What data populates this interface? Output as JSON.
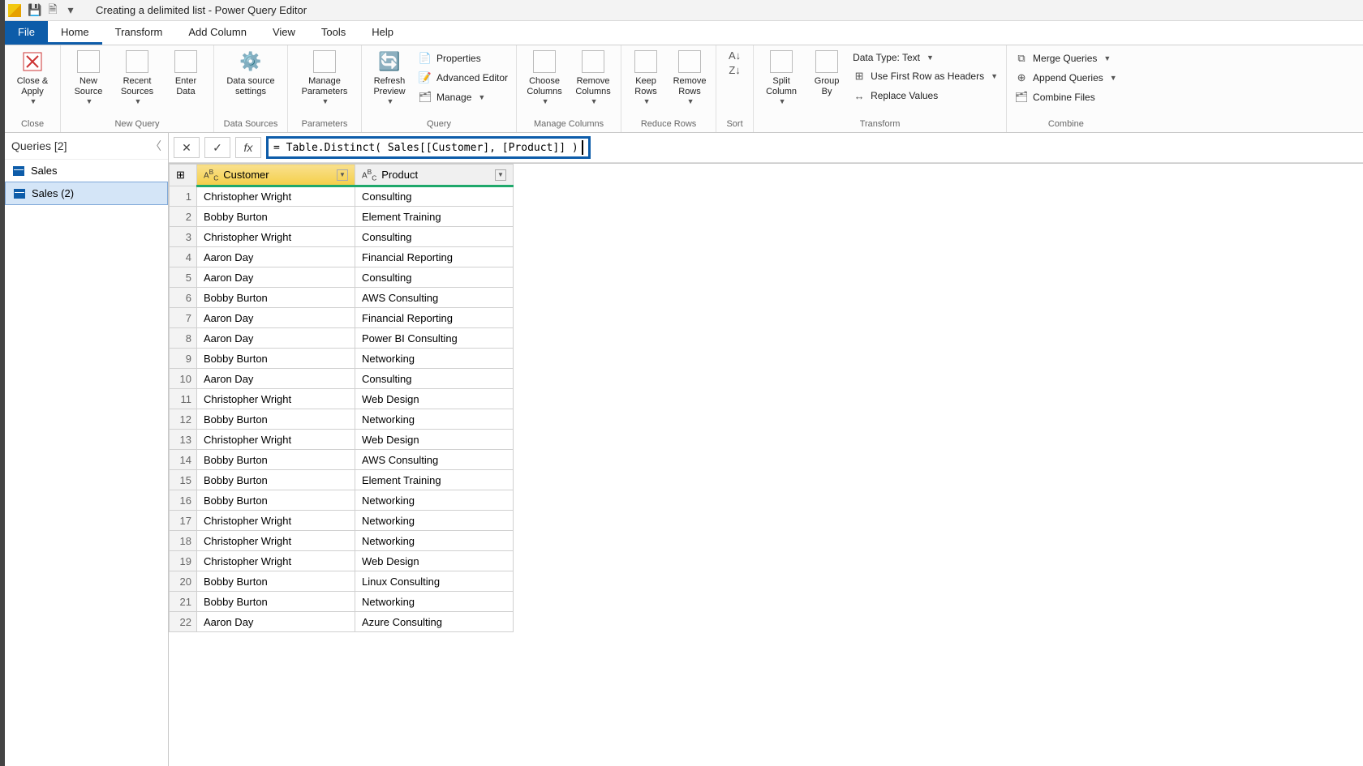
{
  "title": "Creating a delimited list - Power Query Editor",
  "menutabs": {
    "file": "File",
    "home": "Home",
    "transform": "Transform",
    "add_column": "Add Column",
    "view": "View",
    "tools": "Tools",
    "help": "Help"
  },
  "ribbon": {
    "close_group": "Close",
    "close_apply": "Close &\nApply",
    "newquery_group": "New Query",
    "new_source": "New\nSource",
    "recent_sources": "Recent\nSources",
    "enter_data": "Enter\nData",
    "datasources_group": "Data Sources",
    "ds_settings": "Data source\nsettings",
    "parameters_group": "Parameters",
    "manage_parameters": "Manage\nParameters",
    "query_group": "Query",
    "refresh_preview": "Refresh\nPreview",
    "properties": "Properties",
    "advanced_editor": "Advanced Editor",
    "manage": "Manage",
    "manage_cols_group": "Manage Columns",
    "choose_cols": "Choose\nColumns",
    "remove_cols": "Remove\nColumns",
    "reduce_rows_group": "Reduce Rows",
    "keep_rows": "Keep\nRows",
    "remove_rows": "Remove\nRows",
    "sort_group": "Sort",
    "transform_group": "Transform",
    "split_column": "Split\nColumn",
    "group_by": "Group\nBy",
    "data_type": "Data Type: Text",
    "first_row_headers": "Use First Row as Headers",
    "replace_values": "Replace Values",
    "combine_group": "Combine",
    "merge_queries": "Merge Queries",
    "append_queries": "Append Queries",
    "combine_files": "Combine Files"
  },
  "queries": {
    "header": "Queries [2]",
    "items": [
      "Sales",
      "Sales (2)"
    ]
  },
  "formula": "= Table.Distinct( Sales[[Customer], [Product]] )",
  "columns": [
    "Customer",
    "Product"
  ],
  "rows": [
    [
      "Christopher Wright",
      "Consulting"
    ],
    [
      "Bobby Burton",
      "Element Training"
    ],
    [
      "Christopher Wright",
      "Consulting"
    ],
    [
      "Aaron Day",
      "Financial Reporting"
    ],
    [
      "Aaron Day",
      "Consulting"
    ],
    [
      "Bobby Burton",
      "AWS Consulting"
    ],
    [
      "Aaron Day",
      "Financial Reporting"
    ],
    [
      "Aaron Day",
      "Power BI Consulting"
    ],
    [
      "Bobby Burton",
      "Networking"
    ],
    [
      "Aaron Day",
      "Consulting"
    ],
    [
      "Christopher Wright",
      "Web Design"
    ],
    [
      "Bobby Burton",
      "Networking"
    ],
    [
      "Christopher Wright",
      "Web Design"
    ],
    [
      "Bobby Burton",
      "AWS Consulting"
    ],
    [
      "Bobby Burton",
      "Element Training"
    ],
    [
      "Bobby Burton",
      "Networking"
    ],
    [
      "Christopher Wright",
      "Networking"
    ],
    [
      "Christopher Wright",
      "Networking"
    ],
    [
      "Christopher Wright",
      "Web Design"
    ],
    [
      "Bobby Burton",
      "Linux Consulting"
    ],
    [
      "Bobby Burton",
      "Networking"
    ],
    [
      "Aaron Day",
      "Azure Consulting"
    ]
  ]
}
